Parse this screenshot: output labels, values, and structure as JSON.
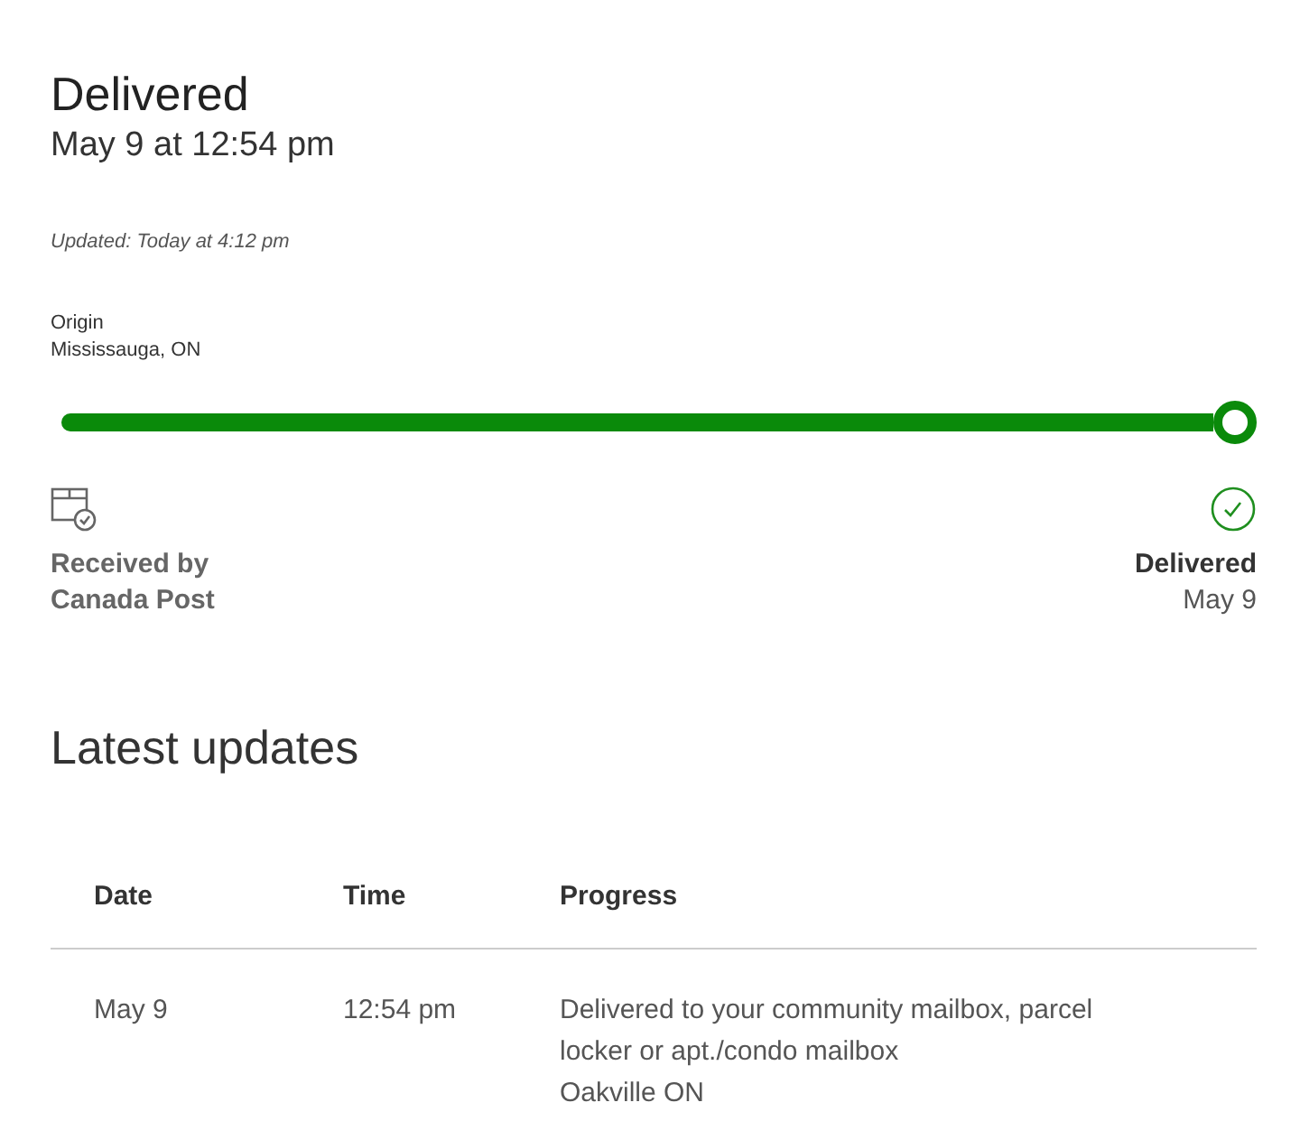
{
  "status": {
    "title": "Delivered",
    "datetime": "May 9 at 12:54 pm",
    "updated": "Updated: Today at 4:12 pm"
  },
  "origin": {
    "label": "Origin",
    "place": "Mississauga, ON"
  },
  "progress": {
    "level": 1,
    "start": {
      "line1": "Received by",
      "line2": "Canada Post"
    },
    "end": {
      "title": "Delivered",
      "date": "May 9"
    }
  },
  "updates": {
    "title": "Latest updates",
    "columns": [
      "Date",
      "Time",
      "Progress"
    ],
    "rows": [
      {
        "date": "May 9",
        "time": "12:54 pm",
        "progress": "Delivered to your community mailbox, parcel locker or apt./condo mailbox",
        "place": "Oakville ON"
      }
    ]
  }
}
